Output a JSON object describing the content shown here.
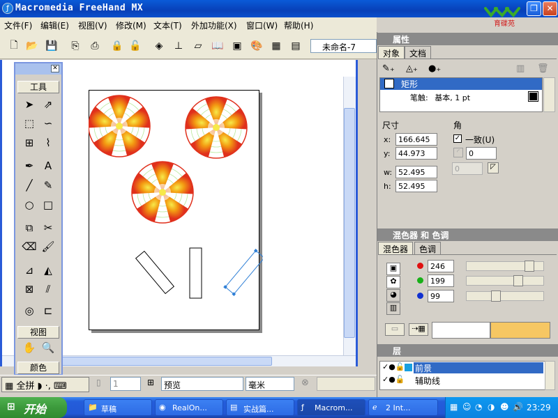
{
  "app": {
    "title": "Macromedia FreeHand MX",
    "logo_text": "育碟苑"
  },
  "menu": [
    "文件(F)",
    "编辑(E)",
    "视图(V)",
    "修改(M)",
    "文本(T)",
    "外加功能(X)",
    "窗口(W)",
    "帮助(H)"
  ],
  "toolbar": {
    "document_select": "未命名-7"
  },
  "tools_panel": {
    "title": "工具",
    "view_label": "视图",
    "color_label": "颜色"
  },
  "properties": {
    "title": "属性",
    "tabs": [
      "对象",
      "文档"
    ],
    "object_name": "矩形",
    "stroke_label": "笔触:",
    "stroke_value": "基本, 1 pt",
    "size_label": "尺寸",
    "x_label": "x:",
    "x_value": "166.645",
    "y_label": "y:",
    "y_value": "44.973",
    "w_label": "w:",
    "w_value": "52.495",
    "h_label": "h:",
    "h_value": "52.495",
    "corner_label": "角",
    "uniform_label": "一致(U)",
    "corner_value": "0",
    "corner_disabled_value": "0"
  },
  "mixer": {
    "title": "混色器 和 色调",
    "tabs": [
      "混色器",
      "色调"
    ],
    "r": "246",
    "g": "199",
    "b": "99",
    "swatch_color": "#f6c763"
  },
  "layers": {
    "title": "层",
    "rows": [
      {
        "name": "前景",
        "selected": true
      },
      {
        "name": "辅助线",
        "selected": false
      }
    ]
  },
  "statusbar": {
    "page_value": "1",
    "mode": "预览",
    "units": "毫米"
  },
  "taskbar": {
    "start": "开始",
    "ime": "全拼",
    "tasks": [
      "草稿",
      "RealOn...",
      "实战篇...",
      "Macrom...",
      "2 Int..."
    ],
    "clock": "23:29"
  },
  "colors": {
    "title_blue": "#0a4fd0",
    "selection_blue": "#316ac5",
    "target_red": "#e0301c",
    "target_orange": "#f39c12",
    "target_yellow": "#f7e94a",
    "target_green": "#b8e89a"
  }
}
